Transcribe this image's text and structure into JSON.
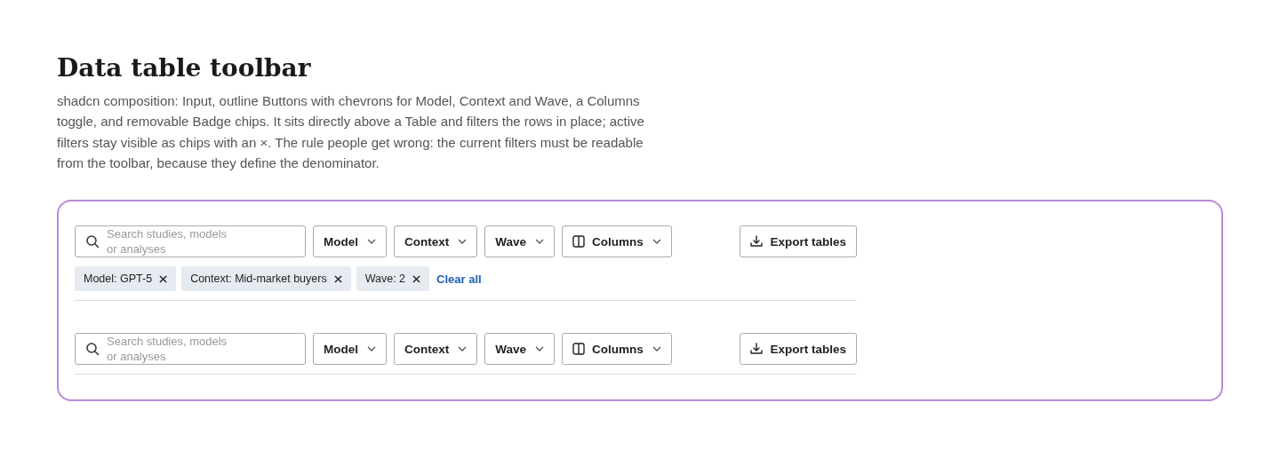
{
  "title": "Data table toolbar",
  "description": "shadcn composition: Input, outline Buttons with chevrons for Model, Context and Wave, a Columns toggle, and removable Badge chips. It sits directly above a Table and filters the rows in place; active filters stay visible as chips with an ×. The rule people get wrong: the current filters must be readable from the toolbar, because they define the denominator.",
  "toolbars": [
    {
      "search": {
        "placeholder": "Search studies, models or analyses"
      },
      "filters": [
        "Model",
        "Context",
        "Wave"
      ],
      "columns_button": "Columns",
      "export_button": "Export tables",
      "chips": [
        "Model: GPT-5",
        "Context: Mid-market buyers",
        "Wave: 2"
      ],
      "clear_all": "Clear all"
    },
    {
      "search": {
        "placeholder": "Search studies, models or analyses"
      },
      "filters": [
        "Model",
        "Context",
        "Wave"
      ],
      "columns_button": "Columns",
      "export_button": "Export tables"
    }
  ]
}
